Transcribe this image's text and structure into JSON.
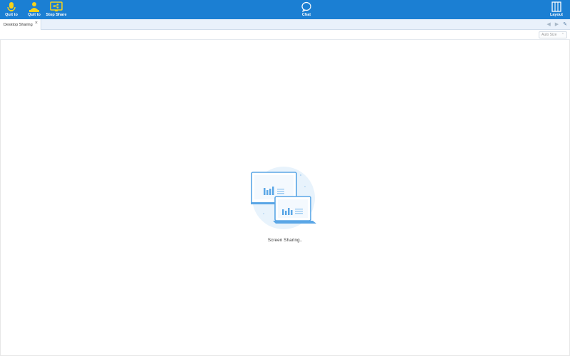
{
  "toolbar": {
    "quit1_label": "Quit to",
    "quit2_label": "Quit to",
    "stop_share_label": "Stop Share",
    "chat_label": "Chat",
    "layout_label": "Layout",
    "background_color": "#1b7fd3",
    "icon_accent_color": "#f5d21c"
  },
  "tabs": [
    {
      "label": "Desktop Sharing",
      "close": "×"
    }
  ],
  "nav": {
    "prev": "◀",
    "next": "▶",
    "pin": "✎"
  },
  "autosize": {
    "label": "Auto Size",
    "arrows": "⌃"
  },
  "main": {
    "status": "Screen Sharing..",
    "illustration_color": "#5aa6e6"
  }
}
